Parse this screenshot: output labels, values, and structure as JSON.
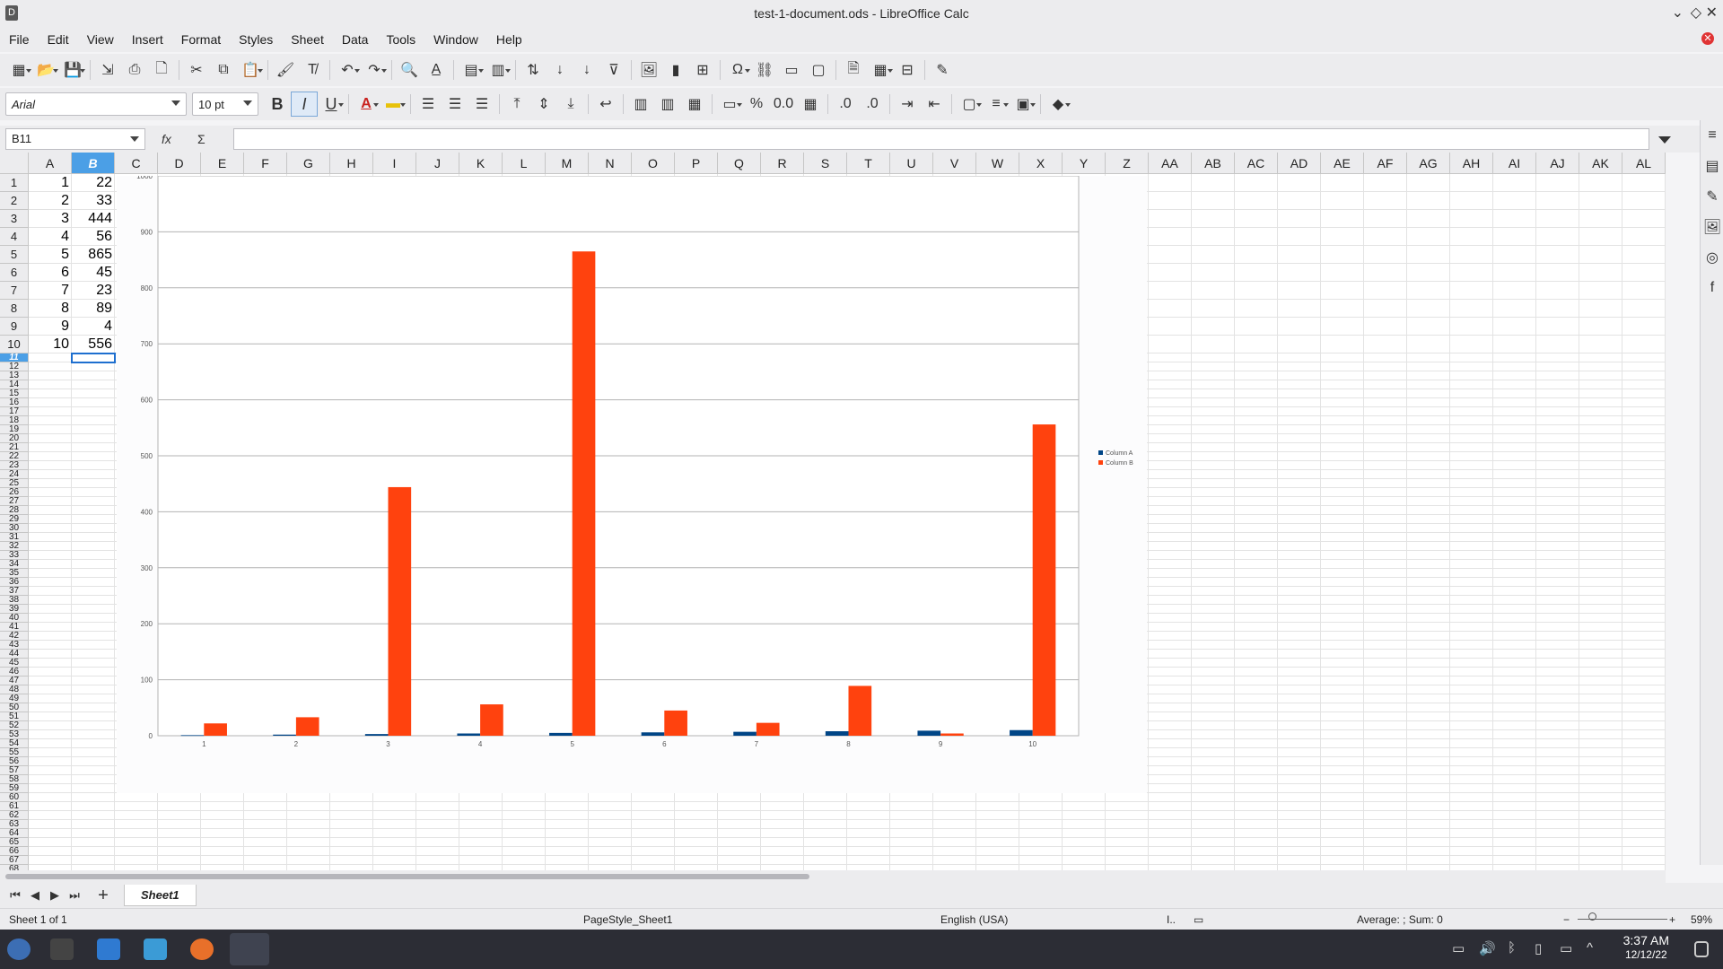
{
  "window": {
    "title": "test-1-document.ods - LibreOffice Calc",
    "app_icon": "D"
  },
  "menu": [
    "File",
    "Edit",
    "View",
    "Insert",
    "Format",
    "Styles",
    "Sheet",
    "Data",
    "Tools",
    "Window",
    "Help"
  ],
  "format_toolbar": {
    "font_name": "Arial",
    "font_size": "10 pt",
    "bold": "B",
    "italic": "I",
    "underline": "U"
  },
  "formula_bar": {
    "name_box": "B11",
    "fx": "fx",
    "sum": "Σ",
    "equals": "="
  },
  "columns": [
    "A",
    "B",
    "C",
    "D",
    "E",
    "F",
    "G",
    "H",
    "I",
    "J",
    "K",
    "L",
    "M",
    "N",
    "O",
    "P",
    "Q",
    "R",
    "S",
    "T",
    "U",
    "V",
    "W",
    "X",
    "Y",
    "Z",
    "AA",
    "AB",
    "AC",
    "AD",
    "AE",
    "AF",
    "AG",
    "AH",
    "AI",
    "AJ",
    "AK",
    "AL"
  ],
  "selected_column": "B",
  "selected_row": 11,
  "cells": {
    "A": [
      1,
      2,
      3,
      4,
      5,
      6,
      7,
      8,
      9,
      10
    ],
    "B": [
      22,
      33,
      444,
      56,
      865,
      45,
      23,
      89,
      4,
      556
    ]
  },
  "chart_data": {
    "type": "bar",
    "categories": [
      "1",
      "2",
      "3",
      "4",
      "5",
      "6",
      "7",
      "8",
      "9",
      "10"
    ],
    "series": [
      {
        "name": "Column A",
        "values": [
          1,
          2,
          3,
          4,
          5,
          6,
          7,
          8,
          9,
          10
        ],
        "color": "#004586"
      },
      {
        "name": "Column B",
        "values": [
          22,
          33,
          444,
          56,
          865,
          45,
          23,
          89,
          4,
          556
        ],
        "color": "#ff420e"
      }
    ],
    "title": "",
    "xlabel": "",
    "ylabel": "",
    "ylim": [
      0,
      1000
    ],
    "yticks": [
      0,
      100,
      200,
      300,
      400,
      500,
      600,
      700,
      800,
      900,
      1000
    ],
    "grid": true,
    "legend": "right"
  },
  "sheet_tabs": {
    "active": "Sheet1",
    "add": "+"
  },
  "status": {
    "sheet_info": "Sheet 1 of 1",
    "page_style": "PageStyle_Sheet1",
    "language": "English (USA)",
    "summary": "Average: ; Sum: 0",
    "zoom": "59%"
  },
  "taskbar": {
    "time": "3:37 AM",
    "date": "12/12/22"
  },
  "colors": {
    "selection": "#4b9fe6",
    "cursor": "#1e6fcf"
  }
}
